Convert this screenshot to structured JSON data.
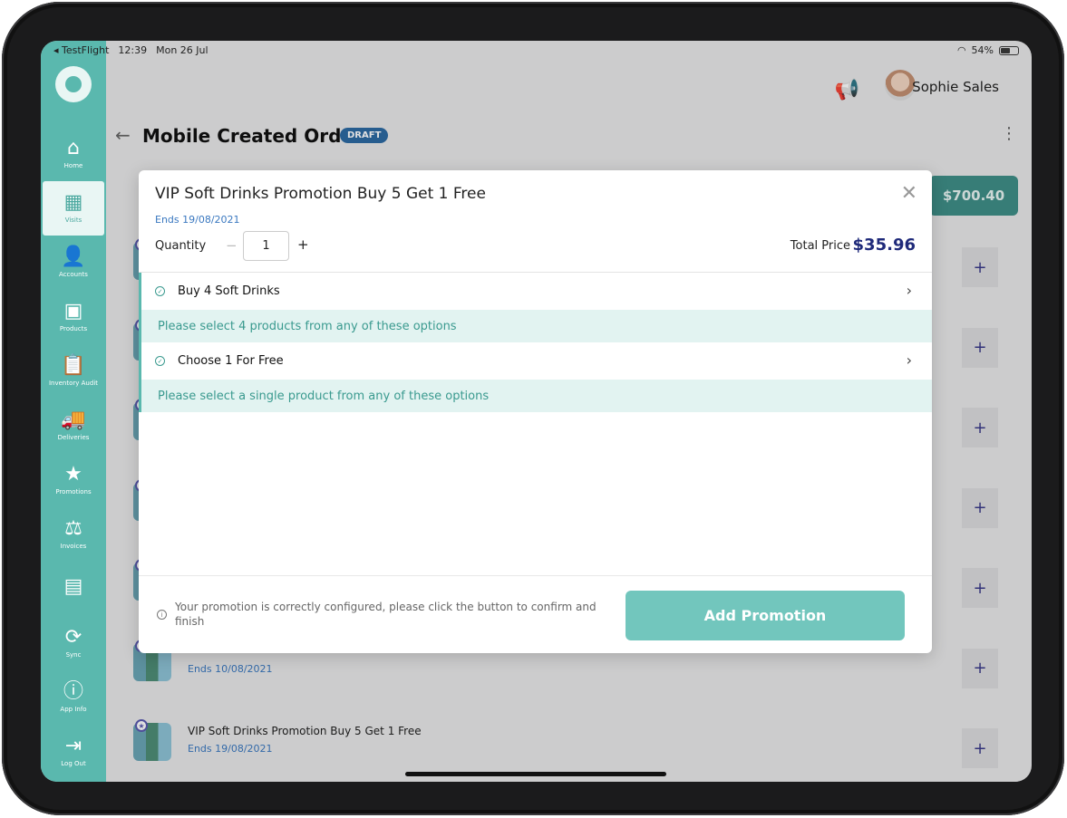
{
  "status_bar": {
    "carrier": "◂ TestFlight",
    "time": "12:39",
    "date": "Mon 26 Jul",
    "battery": "54%"
  },
  "sidebar": {
    "items": [
      {
        "label": "Home",
        "icon": "home-icon",
        "glyph": "⌂"
      },
      {
        "label": "Visits",
        "icon": "store-icon",
        "glyph": "▦"
      },
      {
        "label": "Accounts",
        "icon": "accounts-icon",
        "glyph": "👤"
      },
      {
        "label": "Products",
        "icon": "products-icon",
        "glyph": "▣"
      },
      {
        "label": "Inventory Audit",
        "icon": "clipboard-icon",
        "glyph": "📋"
      },
      {
        "label": "Deliveries",
        "icon": "truck-icon",
        "glyph": "🚚"
      },
      {
        "label": "Promotions",
        "icon": "star-icon",
        "glyph": "★"
      },
      {
        "label": "Invoices",
        "icon": "scales-icon",
        "glyph": "⚖"
      },
      {
        "label": "",
        "icon": "id-card-icon",
        "glyph": "▤"
      },
      {
        "label": "Sync",
        "icon": "sync-icon",
        "glyph": "⟳"
      },
      {
        "label": "App Info",
        "icon": "info-icon",
        "glyph": "ⓘ"
      },
      {
        "label": "Log Out",
        "icon": "logout-icon",
        "glyph": "⇥"
      }
    ],
    "active": "Visits"
  },
  "header": {
    "username": "Sophie Sales",
    "page_title": "Mobile Created Order",
    "badge": "DRAFT"
  },
  "background": {
    "total": "$700.40",
    "rows": [
      {
        "title": "",
        "ends": ""
      },
      {
        "title": "",
        "ends": ""
      },
      {
        "title": "",
        "ends": ""
      },
      {
        "title": "",
        "ends": ""
      },
      {
        "title": "",
        "ends": ""
      },
      {
        "title": "",
        "ends": "Ends 10/08/2021"
      },
      {
        "title": "VIP Soft Drinks Promotion Buy 5 Get 1 Free",
        "ends": "Ends 19/08/2021"
      }
    ],
    "plus": "+"
  },
  "modal": {
    "title": "VIP Soft Drinks Promotion Buy 5 Get 1 Free",
    "ends": "Ends 19/08/2021",
    "quantity_label": "Quantity",
    "quantity_value": "1",
    "minus": "−",
    "plus": "+",
    "total_label": "Total Price",
    "total_value": "$35.96",
    "steps": [
      {
        "label": "Buy 4 Soft Drinks",
        "hint": "Please select 4 products from any of these options"
      },
      {
        "label": "Choose 1 For Free",
        "hint": "Please select a single product from any of these options"
      }
    ],
    "footer_message": "Your promotion is correctly configured, please click the button to confirm and finish",
    "add_button": "Add Promotion"
  }
}
